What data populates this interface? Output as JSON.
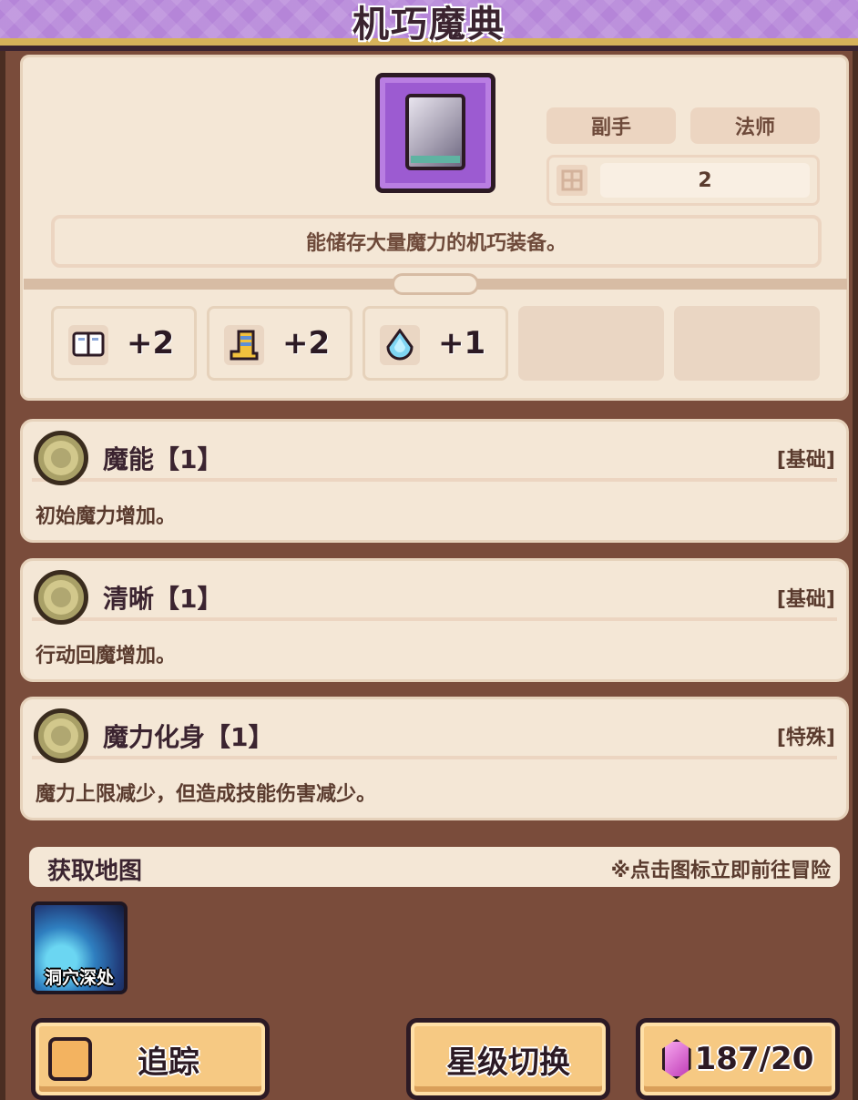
{
  "header": {
    "title": "机巧魔典"
  },
  "item": {
    "icon": "grimoire-book-icon",
    "tags": [
      "副手",
      "法师"
    ],
    "level_value": "2",
    "description": "能储存大量魔力的机巧装备。"
  },
  "stats": [
    {
      "icon": "book-icon",
      "value": "+2"
    },
    {
      "icon": "boot-icon",
      "value": "+2"
    },
    {
      "icon": "mana-drop-icon",
      "value": "+1"
    }
  ],
  "skills": [
    {
      "name": "魔能【1】",
      "type": "[基础]",
      "desc": "初始魔力增加。"
    },
    {
      "name": "清晰【1】",
      "type": "[基础]",
      "desc": "行动回魔增加。"
    },
    {
      "name": "魔力化身【1】",
      "type": "[特殊]",
      "desc": "魔力上限减少，但造成技能伤害减少。"
    }
  ],
  "maps": {
    "title": "获取地图",
    "hint": "※点击图标立即前往冒险",
    "items": [
      {
        "label": "洞穴深处"
      }
    ]
  },
  "buttons": {
    "track": "追踪",
    "star_switch": "星级切换",
    "gem_count": "187/20"
  },
  "colors": {
    "title_bar": "#b585d8",
    "card_bg": "#f4e7d6",
    "button": "#f6c983",
    "frame": "#7a4c3b"
  }
}
